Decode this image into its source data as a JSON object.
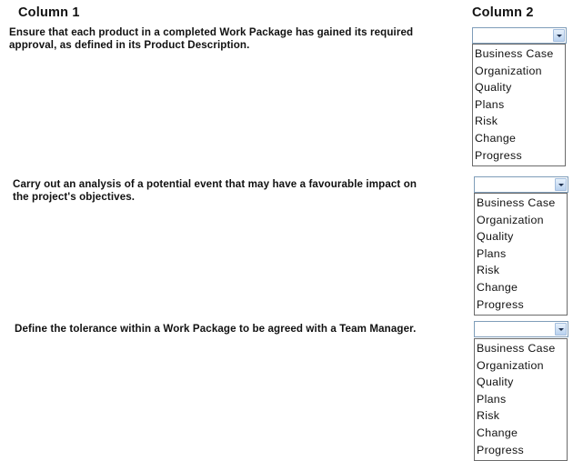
{
  "headers": {
    "column1": "Column 1",
    "column2": "Column 2"
  },
  "rows": [
    {
      "prompt": "Ensure that each product in a completed Work Package has gained its required approval, as defined in its Product Description.",
      "prompt_lines": [
        "Ensure that each product in a completed Work Package has gained its required",
        "approval, as defined in its Product Description."
      ],
      "selected": "",
      "options": [
        "Business Case",
        "Organization",
        "Quality",
        "Plans",
        "Risk",
        "Change",
        "Progress"
      ]
    },
    {
      "prompt": "Carry out an analysis of a potential event that may have a favourable impact on the project's objectives.",
      "prompt_lines": [
        "Carry out an analysis of a potential event that may have a favourable impact on",
        "the project's objectives."
      ],
      "selected": "",
      "options": [
        "Business Case",
        "Organization",
        "Quality",
        "Plans",
        "Risk",
        "Change",
        "Progress"
      ]
    },
    {
      "prompt": "Define the tolerance within a Work Package to be agreed with a Team Manager.",
      "prompt_lines": [
        "Define the tolerance within a Work Package to be agreed with a Team Manager."
      ],
      "selected": "",
      "options": [
        "Business Case",
        "Organization",
        "Quality",
        "Plans",
        "Risk",
        "Change",
        "Progress"
      ]
    }
  ],
  "icons": {
    "dropdown": "chevron-down-icon"
  }
}
